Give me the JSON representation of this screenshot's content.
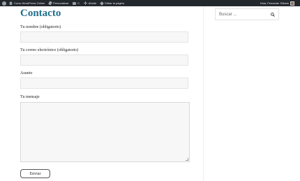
{
  "adminbar": {
    "site_name": "Curso WordPress Online",
    "customize": "Personalizar",
    "comments_count": "0",
    "new": "Añadir",
    "edit_page": "Editar la página",
    "greeting": "Hola, Fernando Tellado"
  },
  "main": {
    "title": "Contacto",
    "form": {
      "name_label": "Tu nombre (obligatorio)",
      "email_label": "Tu correo electrónico (obligatorio)",
      "subject_label": "Asunto",
      "message_label": "Tu mensaje",
      "name_value": "",
      "email_value": "",
      "subject_value": "",
      "message_value": "",
      "submit_label": "Enviar"
    }
  },
  "sidebar": {
    "search_placeholder": "Buscar ..."
  },
  "colors": {
    "adminbar_bg": "#23282d",
    "title": "#1f6e8c",
    "field_bg": "#f7f7f7"
  },
  "icons": [
    "wordpress-logo-icon",
    "home-icon",
    "brush-icon",
    "comment-icon",
    "plus-icon",
    "pencil-icon",
    "avatar-icon",
    "search-icon"
  ]
}
